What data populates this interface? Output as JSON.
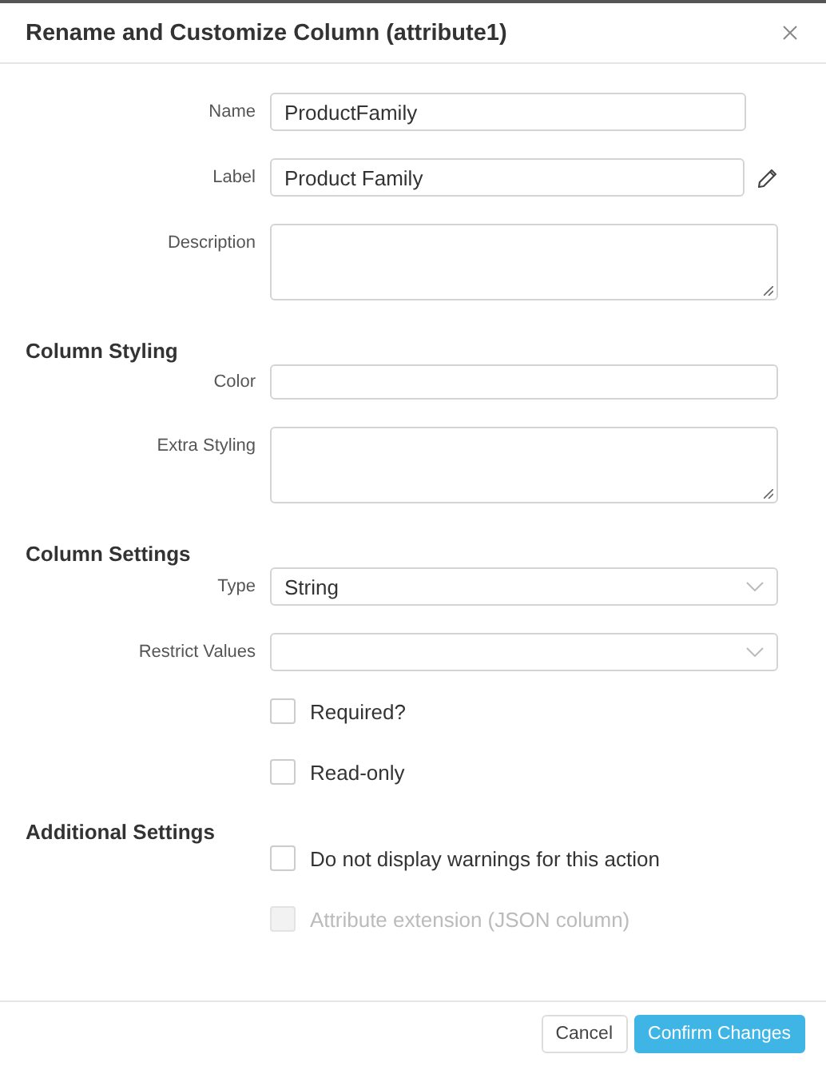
{
  "dialog": {
    "title": "Rename and Customize Column (attribute1)"
  },
  "rows": [
    {
      "kind": "input",
      "label": "Name",
      "value": "ProductFamily"
    },
    {
      "kind": "input_edit",
      "label": "Label",
      "value": "Product Family"
    },
    {
      "kind": "textarea",
      "label": "Description"
    },
    {
      "kind": "heading",
      "text": "Column Styling"
    },
    {
      "kind": "input",
      "label": "Color"
    },
    {
      "kind": "textarea",
      "label": "Extra Styling"
    },
    {
      "kind": "heading",
      "text": "Column Settings"
    },
    {
      "kind": "select",
      "label": "Type",
      "value": "String"
    },
    {
      "kind": "select",
      "label": "Restrict Values"
    },
    {
      "kind": "checkbox",
      "text": "Required?",
      "checked": false,
      "disabled": false
    },
    {
      "kind": "checkbox",
      "text": "Read-only",
      "checked": false,
      "disabled": false
    },
    {
      "kind": "heading",
      "text": "Additional Settings"
    },
    {
      "kind": "checkbox",
      "text": "Do not display warnings for this action",
      "checked": false,
      "disabled": false
    },
    {
      "kind": "checkbox",
      "text": "Attribute extension (JSON column)",
      "checked": false,
      "disabled": true
    }
  ],
  "buttons": [
    {
      "label": "Cancel",
      "primary": false
    },
    {
      "label": "Confirm Changes",
      "primary": true
    }
  ]
}
